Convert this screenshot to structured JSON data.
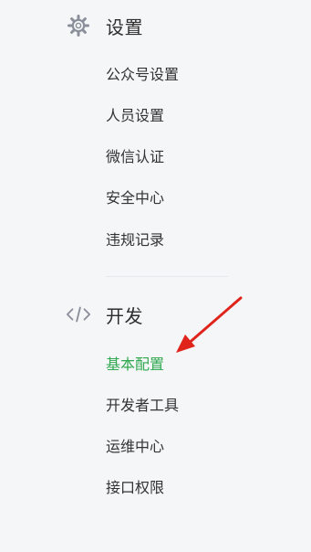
{
  "sections": {
    "settings": {
      "title": "设置",
      "icon": "gear-icon",
      "items": [
        "公众号设置",
        "人员设置",
        "微信认证",
        "安全中心",
        "违规记录"
      ]
    },
    "develop": {
      "title": "开发",
      "icon": "code-icon",
      "items": [
        "基本配置",
        "开发者工具",
        "运维中心",
        "接口权限"
      ],
      "active_item": "基本配置"
    }
  },
  "colors": {
    "active": "#2fa84f",
    "arrow": "#e0241b",
    "icon": "#8a8f99"
  }
}
